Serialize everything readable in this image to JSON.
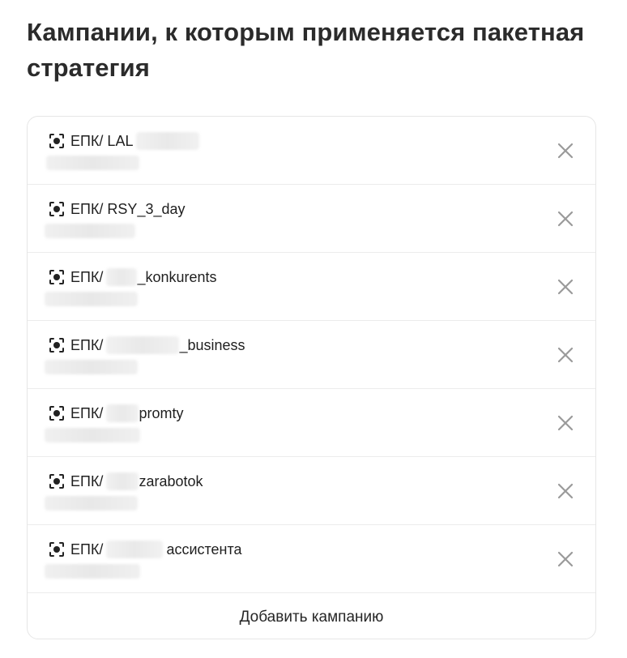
{
  "header": {
    "title": "Кампании, к которым применяется пакетная стратегия"
  },
  "campaigns": [
    {
      "prefix": "ЕПК/ LAL",
      "middle": "",
      "suffix": ""
    },
    {
      "prefix": "ЕПК/ RSY_3_day",
      "middle": "",
      "suffix": ""
    },
    {
      "prefix": "ЕПК/",
      "middle": "",
      "suffix": "_konkurents"
    },
    {
      "prefix": "ЕПК/",
      "middle": "",
      "suffix": "_business"
    },
    {
      "prefix": "ЕПК/",
      "middle": "",
      "suffix": "promty"
    },
    {
      "prefix": "ЕПК/",
      "middle": "",
      "suffix": "zarabotok"
    },
    {
      "prefix": "ЕПК/",
      "middle": "",
      "suffix": "ассистента"
    }
  ],
  "actions": {
    "add_campaign_label": "Добавить кампанию"
  },
  "icons": {
    "campaign": "campaign-target-icon",
    "remove": "close-icon"
  },
  "colors": {
    "text": "#1f1f1f",
    "icon_remove": "#9a9a9a",
    "border": "#e6e6e6"
  }
}
